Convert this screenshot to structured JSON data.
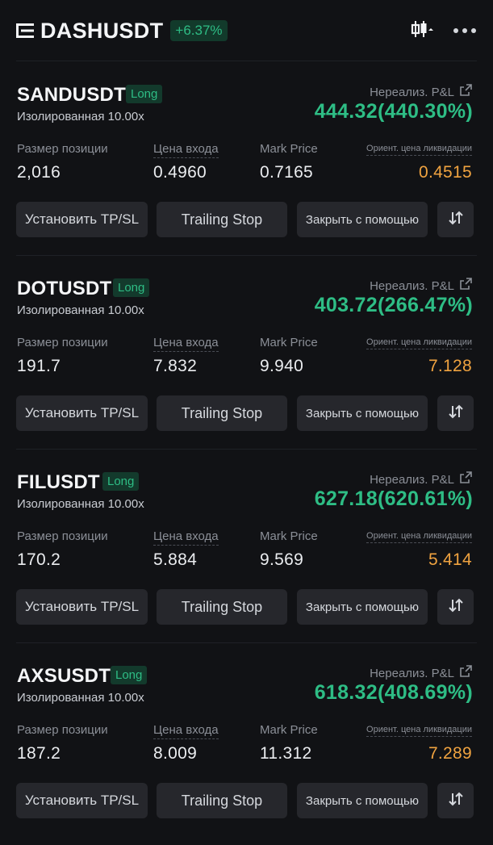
{
  "header": {
    "symbol": "DASHUSDT",
    "change": "+6.37%",
    "icons": [
      "menu-icon",
      "candlestick-icon",
      "more-icon"
    ]
  },
  "labels": {
    "margin_mode": "Изолированная 10.00x",
    "pnl": "Нереализ. P&L",
    "size": "Размер позиции",
    "entry": "Цена входа",
    "mark": "Mark Price",
    "liq": "Ориент. цена ликвидации",
    "tpsl_button": "Установить TP/SL",
    "trailing_button": "Trailing Stop",
    "close_button": "Закрыть с помощью"
  },
  "colors": {
    "background": "#111215",
    "profit": "#2ebd85",
    "liquidation": "#f0a340",
    "button": "#26272c"
  },
  "positions": [
    {
      "pair": "SANDUSDT",
      "side": "Long",
      "pnl": "444.32(440.30%)",
      "size": "2,016",
      "entry": "0.4960",
      "mark": "0.7165",
      "liq": "0.4515"
    },
    {
      "pair": "DOTUSDT",
      "side": "Long",
      "pnl": "403.72(266.47%)",
      "size": "191.7",
      "entry": "7.832",
      "mark": "9.940",
      "liq": "7.128"
    },
    {
      "pair": "FILUSDT",
      "side": "Long",
      "pnl": "627.18(620.61%)",
      "size": "170.2",
      "entry": "5.884",
      "mark": "9.569",
      "liq": "5.414"
    },
    {
      "pair": "AXSUSDT",
      "side": "Long",
      "pnl": "618.32(408.69%)",
      "size": "187.2",
      "entry": "8.009",
      "mark": "11.312",
      "liq": "7.289"
    }
  ]
}
